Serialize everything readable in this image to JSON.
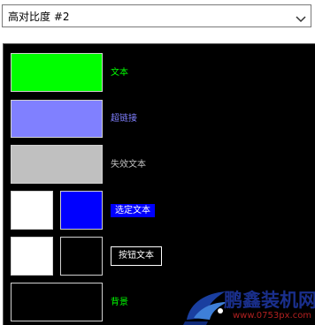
{
  "theme_select": {
    "value": "高对比度 #2",
    "icon": "chevron-down-icon"
  },
  "preview": {
    "background": "#000000",
    "rows": [
      {
        "name": "text",
        "label": "文本",
        "swatch_color": "#00ff00",
        "label_color": "#00ff00"
      },
      {
        "name": "hyperlink",
        "label": "超链接",
        "swatch_color": "#8080ff",
        "label_color": "#8080ff"
      },
      {
        "name": "disabled-text",
        "label": "失效文本",
        "swatch_color": "#c0c0c0",
        "label_color": "#c0c0c0"
      },
      {
        "name": "selected-text",
        "label": "选定文本",
        "swatch_bg": "#ffffff",
        "swatch_fg": "#0000ff",
        "label_color": "#ffffff",
        "label_bg": "#0000ff"
      },
      {
        "name": "button-text",
        "label": "按钮文本",
        "swatch_bg": "#ffffff",
        "swatch_fg": "#000000",
        "label_color": "#ffffff"
      },
      {
        "name": "background",
        "label": "背景",
        "swatch_color": "#000000",
        "label_color": "#00ff00"
      }
    ]
  },
  "watermark": {
    "title": "鹏鑫装机网",
    "url": "www.0753px.com",
    "icon": "logo-icon"
  }
}
